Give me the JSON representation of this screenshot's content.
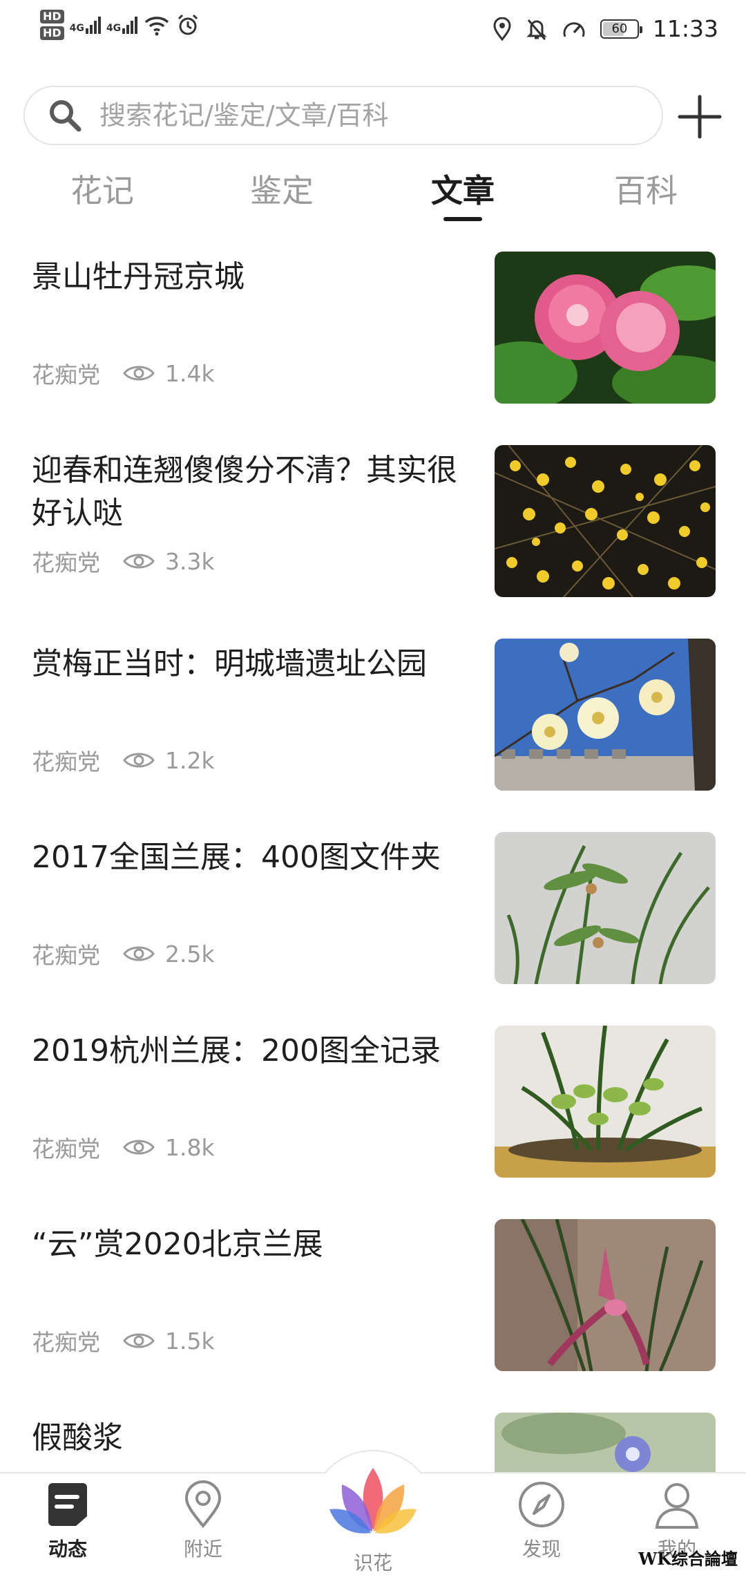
{
  "status_bar": {
    "sim1": "HD",
    "sim2": "HD",
    "net1": "4G",
    "net2": "4G",
    "battery": "60",
    "time": "11:33"
  },
  "search": {
    "placeholder": "搜索花记/鉴定/文章/百科"
  },
  "tabs": [
    {
      "label": "花记",
      "active": false
    },
    {
      "label": "鉴定",
      "active": false
    },
    {
      "label": "文章",
      "active": true
    },
    {
      "label": "百科",
      "active": false
    }
  ],
  "articles": [
    {
      "title": "景山牡丹冠京城",
      "author": "花痴党",
      "views": "1.4k",
      "thumb": "peony"
    },
    {
      "title": "迎春和连翘傻傻分不清？其实很好认哒",
      "author": "花痴党",
      "views": "3.3k",
      "thumb": "jasmine"
    },
    {
      "title": "赏梅正当时：明城墙遗址公园",
      "author": "花痴党",
      "views": "1.2k",
      "thumb": "plum"
    },
    {
      "title": "2017全国兰展：400图文件夹",
      "author": "花痴党",
      "views": "2.5k",
      "thumb": "orchid-grey"
    },
    {
      "title": "2019杭州兰展：200图全记录",
      "author": "花痴党",
      "views": "1.8k",
      "thumb": "orchid-pot"
    },
    {
      "title": "“云”赏2020北京兰展",
      "author": "花痴党",
      "views": "1.5k",
      "thumb": "orchid-red"
    },
    {
      "title": "假酸浆",
      "author": "",
      "views": "",
      "thumb": "blue-flower"
    }
  ],
  "bottom_nav": [
    {
      "label": "动态",
      "icon": "feed-icon",
      "active": true
    },
    {
      "label": "附近",
      "icon": "location-pin-icon",
      "active": false
    },
    {
      "label": "识花",
      "icon": "lotus-icon",
      "active": false
    },
    {
      "label": "发现",
      "icon": "compass-icon",
      "active": false
    },
    {
      "label": "我的",
      "icon": "user-icon",
      "active": false
    }
  ],
  "watermark": "WK综合論壇",
  "colors": {
    "text": "#1e1e1e",
    "muted": "#9a9a9a",
    "border": "#e4e4e4"
  }
}
